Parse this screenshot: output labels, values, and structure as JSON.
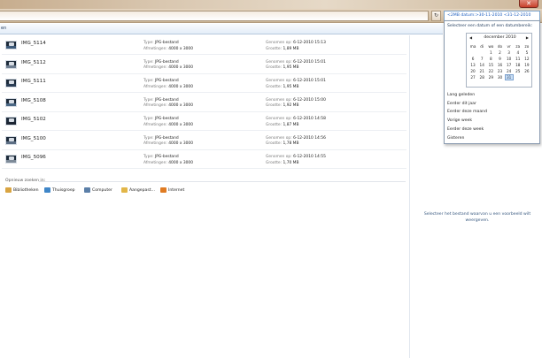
{
  "window": {
    "close_glyph": "✕"
  },
  "nav": {
    "refresh_glyph": "↻",
    "search_query": "<2MB datum:>30-11-2010 <31-12-2010"
  },
  "toolbar": {
    "label_fragment": "en"
  },
  "files": [
    {
      "name": "IMG_5114",
      "type_label": "Type:",
      "type": "JPG-bestand",
      "dim_label": "Afmetingen:",
      "dimensions": "4000 x 3000",
      "date_label": "Genomen op:",
      "date": "6-12-2010 15:13",
      "size_label": "Grootte:",
      "size": "1,89 MB"
    },
    {
      "name": "IMG_5112",
      "type_label": "Type:",
      "type": "JPG-bestand",
      "dim_label": "Afmetingen:",
      "dimensions": "4000 x 3000",
      "date_label": "Genomen op:",
      "date": "6-12-2010 15:01",
      "size_label": "Grootte:",
      "size": "1,95 MB"
    },
    {
      "name": "IMG_5111",
      "type_label": "Type:",
      "type": "JPG-bestand",
      "dim_label": "Afmetingen:",
      "dimensions": "4000 x 3000",
      "date_label": "Genomen op:",
      "date": "6-12-2010 15:01",
      "size_label": "Grootte:",
      "size": "1,95 MB"
    },
    {
      "name": "IMG_5108",
      "type_label": "Type:",
      "type": "JPG-bestand",
      "dim_label": "Afmetingen:",
      "dimensions": "4000 x 3000",
      "date_label": "Genomen op:",
      "date": "6-12-2010 15:00",
      "size_label": "Grootte:",
      "size": "1,92 MB"
    },
    {
      "name": "IMG_5102",
      "type_label": "Type:",
      "type": "JPG-bestand",
      "dim_label": "Afmetingen:",
      "dimensions": "4000 x 3000",
      "date_label": "Genomen op:",
      "date": "6-12-2010 14:58",
      "size_label": "Grootte:",
      "size": "1,87 MB"
    },
    {
      "name": "IMG_5100",
      "type_label": "Type:",
      "type": "JPG-bestand",
      "dim_label": "Afmetingen:",
      "dimensions": "4000 x 3000",
      "date_label": "Genomen op:",
      "date": "6-12-2010 14:56",
      "size_label": "Grootte:",
      "size": "1,78 MB"
    },
    {
      "name": "IMG_5096",
      "type_label": "Type:",
      "type": "JPG-bestand",
      "dim_label": "Afmetingen:",
      "dimensions": "4000 x 3000",
      "date_label": "Genomen op:",
      "date": "6-12-2010 14:55",
      "size_label": "Grootte:",
      "size": "1,70 MB"
    }
  ],
  "search_again": {
    "header": "Opnieuw zoeken in:",
    "locations": [
      {
        "label": "Bibliotheken",
        "icon": "libraries-icon",
        "color": "#d9a441"
      },
      {
        "label": "Thuisgroep",
        "icon": "homegroup-icon",
        "color": "#3f86c8"
      },
      {
        "label": "Computer",
        "icon": "computer-icon",
        "color": "#5b7fa8"
      },
      {
        "label": "Aangepast...",
        "icon": "folder-icon",
        "color": "#e2b648"
      },
      {
        "label": "Internet",
        "icon": "internet-icon",
        "color": "#e07b22"
      }
    ]
  },
  "preview": {
    "message": "Selecteer het bestand waarvan u een voorbeeld wilt weergeven."
  },
  "date_picker": {
    "prompt": "Selecteer een datum of een datumbereik:",
    "prev_glyph": "◀",
    "next_glyph": "▶",
    "month_label": "december 2010",
    "weekdays": [
      "ma",
      "di",
      "wo",
      "do",
      "vr",
      "za",
      "zo"
    ],
    "days": [
      [
        "",
        "",
        "1",
        "2",
        "3",
        "4",
        "5"
      ],
      [
        "6",
        "7",
        "8",
        "9",
        "10",
        "11",
        "12"
      ],
      [
        "13",
        "14",
        "15",
        "16",
        "17",
        "18",
        "19"
      ],
      [
        "20",
        "21",
        "22",
        "23",
        "24",
        "25",
        "26"
      ],
      [
        "27",
        "28",
        "29",
        "30",
        "31",
        "",
        ""
      ]
    ],
    "selected_day": "31",
    "presets": [
      "Lang geleden",
      "Eerder dit jaar",
      "Eerder deze maand",
      "Vorige week",
      "Eerder deze week",
      "Gisteren"
    ]
  }
}
